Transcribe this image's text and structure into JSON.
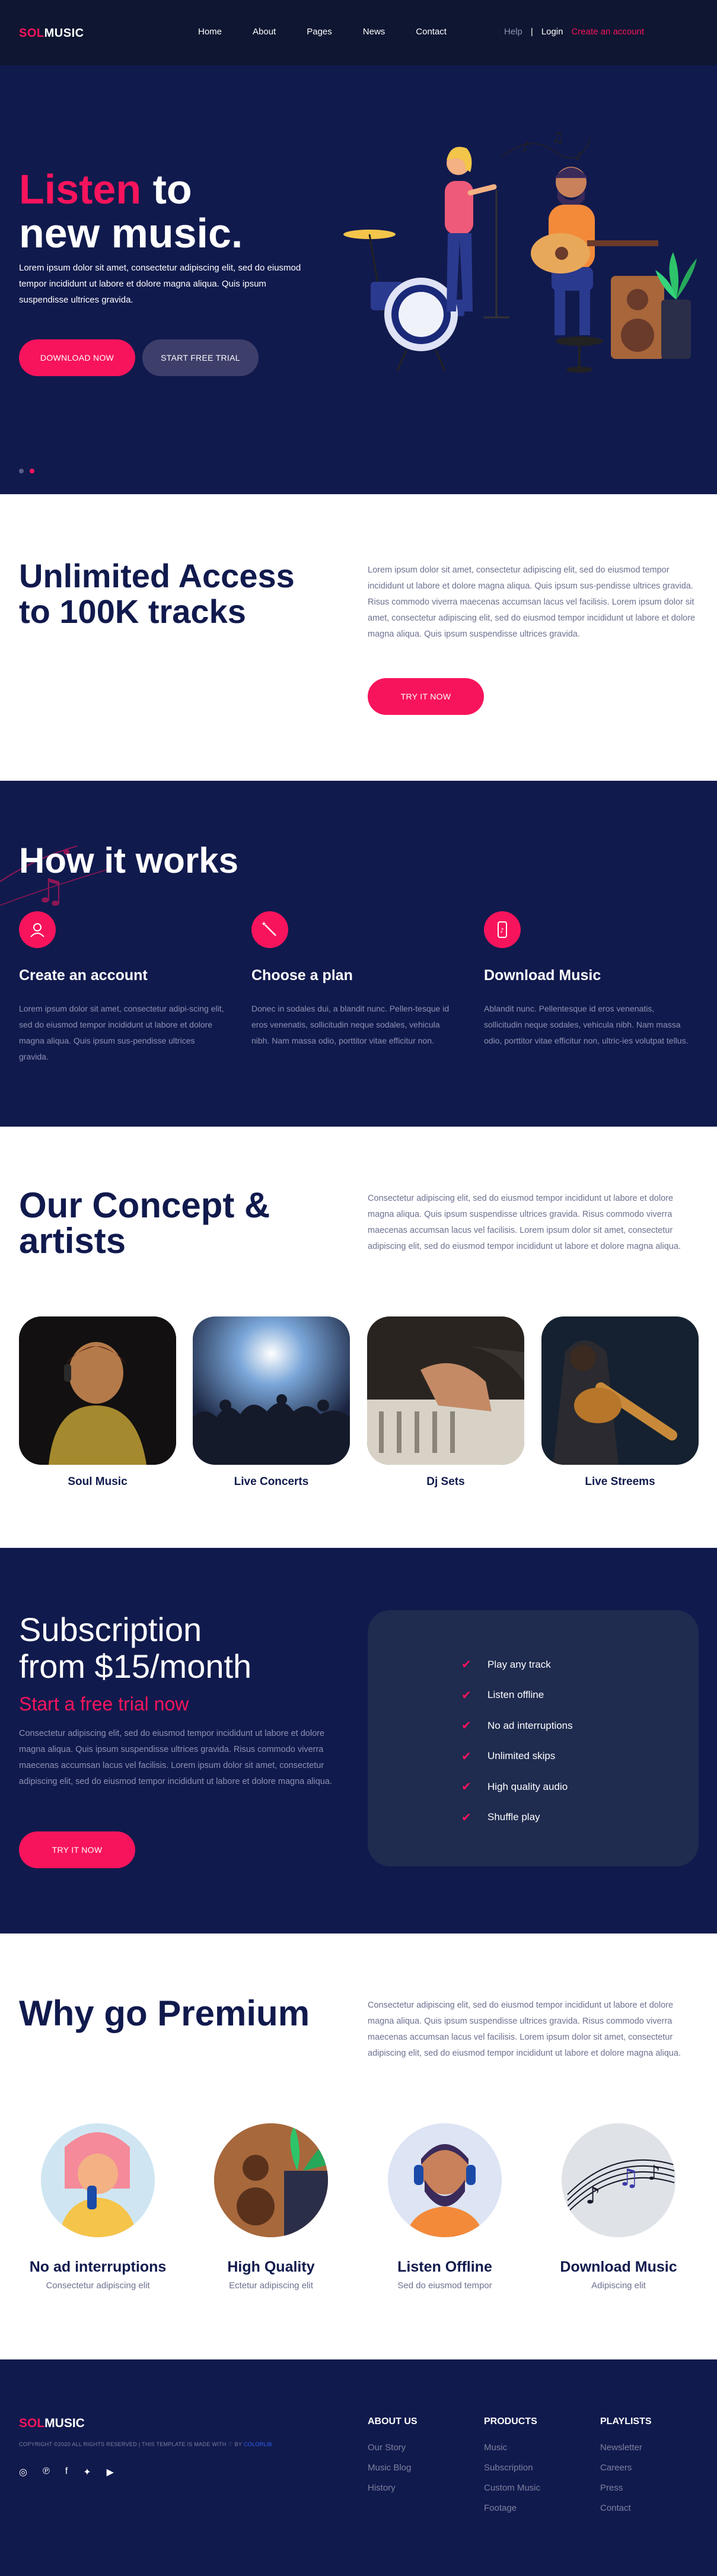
{
  "header": {
    "logo_part1": "SOL",
    "logo_part2": "MUSIC",
    "nav": [
      "Home",
      "About",
      "Pages",
      "News",
      "Contact"
    ],
    "help": "Help",
    "separator": "|",
    "login": "Login",
    "create_account": "Create an account"
  },
  "hero": {
    "title_accent": "Listen",
    "title_rest1": " to",
    "title_rest2": "new music.",
    "text": "Lorem ipsum dolor sit amet, consectetur adipiscing elit, sed do eiusmod tempor incididunt ut labore et dolore magna aliqua. Quis ipsum suspendisse ultrices gravida.",
    "download_btn": "DOWNLOAD NOW",
    "trial_btn": "START FREE TRIAL"
  },
  "unlimited": {
    "title_line1": "Unlimited Access",
    "title_line2": "to 100K tracks",
    "text": "Lorem ipsum dolor sit amet, consectetur adipiscing elit, sed do eiusmod tempor incididunt ut labore et dolore magna aliqua. Quis ipsum sus-pendisse ultrices gravida. Risus commodo viverra maecenas accumsan lacus vel facilisis. Lorem ipsum dolor sit amet, consectetur adipiscing elit, sed do eiusmod tempor incididunt ut labore et dolore magna aliqua. Quis ipsum suspendisse ultrices gravida.",
    "button": "TRY IT NOW"
  },
  "how": {
    "title": "How it works",
    "steps": [
      {
        "title": "Create an account",
        "text": "Lorem ipsum dolor sit amet, consectetur adipi-scing elit, sed do eiusmod tempor incididunt ut labore et dolore magna aliqua. Quis ipsum sus-pendisse ultrices gravida.",
        "icon": "user-icon"
      },
      {
        "title": "Choose a plan",
        "text": "Donec in sodales dui, a blandit nunc. Pellen-tesque id eros venenatis, sollicitudin neque sodales, vehicula nibh. Nam massa odio, porttitor vitae efficitur non.",
        "icon": "magic-wand-icon"
      },
      {
        "title": "Download Music",
        "text": "Ablandit nunc. Pellentesque id eros venenatis, sollicitudin neque sodales, vehicula nibh. Nam massa odio, porttitor vitae efficitur non, ultric-ies volutpat tellus.",
        "icon": "phone-music-icon"
      }
    ]
  },
  "concept": {
    "title_line1": "Our Concept &",
    "title_line2": "artists",
    "text": "Consectetur adipiscing elit, sed do eiusmod tempor incididunt ut labore et dolore magna aliqua. Quis ipsum suspendisse ultrices gravida. Risus commodo viverra maecenas accumsan lacus vel facilisis. Lorem ipsum dolor sit amet, consectetur adipiscing elit, sed do eiusmod tempor incididunt ut labore et dolore magna aliqua.",
    "artists": [
      "Soul Music",
      "Live Concerts",
      "Dj Sets",
      "Live Streems"
    ]
  },
  "subscription": {
    "title_line1": "Subscription",
    "title_line2": "from $15/month",
    "trial": "Start a free trial now",
    "text": "Consectetur adipiscing elit, sed do eiusmod tempor incididunt ut labore et dolore magna aliqua. Quis ipsum suspendisse ultrices gravida. Risus commodo viverra maecenas accumsan lacus vel facilisis. Lorem ipsum dolor sit amet, consectetur adipiscing elit, sed do eiusmod tempor incididunt ut labore et dolore magna aliqua.",
    "button": "TRY IT NOW",
    "check": "✔",
    "features": [
      "Play any track",
      "Listen offline",
      "No ad interruptions",
      "Unlimited skips",
      "High quality audio",
      "Shuffle play"
    ]
  },
  "premium": {
    "title": "Why go Premium",
    "text": "Consectetur adipiscing elit, sed do eiusmod tempor incididunt ut labore et dolore magna aliqua. Quis ipsum suspendisse ultrices gravida. Risus commodo viverra maecenas accumsan lacus vel facilisis. Lorem ipsum dolor sit amet, consectetur adipiscing elit, sed do eiusmod tempor incididunt ut labore et dolore magna aliqua.",
    "features": [
      {
        "title": "No ad interruptions",
        "sub": "Consectetur adipiscing elit"
      },
      {
        "title": "High Quality",
        "sub": "Ectetur adipiscing elit"
      },
      {
        "title": "Listen Offline",
        "sub": "Sed do eiusmod tempor"
      },
      {
        "title": "Download Music",
        "sub": "Adipiscing elit"
      }
    ]
  },
  "footer": {
    "logo_part1": "SOL",
    "logo_part2": "MUSIC",
    "copyright": "COPYRIGHT ©2020 ALL RIGHTS RESERVED | THIS TEMPLATE IS MADE WITH ♡ BY ",
    "copyright_link": "COLORLIB",
    "social": [
      "instagram-icon",
      "pinterest-icon",
      "facebook-icon",
      "twitter-icon",
      "youtube-icon"
    ],
    "columns": [
      {
        "title": "ABOUT US",
        "links": [
          "Our Story",
          "Music Blog",
          "History"
        ]
      },
      {
        "title": "PRODUCTS",
        "links": [
          "Music",
          "Subscription",
          "Custom Music",
          "Footage"
        ]
      },
      {
        "title": "PLAYLISTS",
        "links": [
          "Newsletter",
          "Careers",
          "Press",
          "Contact"
        ]
      }
    ]
  },
  "colors": {
    "navy": "#111a4d",
    "pink": "#f8145c",
    "card": "#1f2b4f"
  }
}
